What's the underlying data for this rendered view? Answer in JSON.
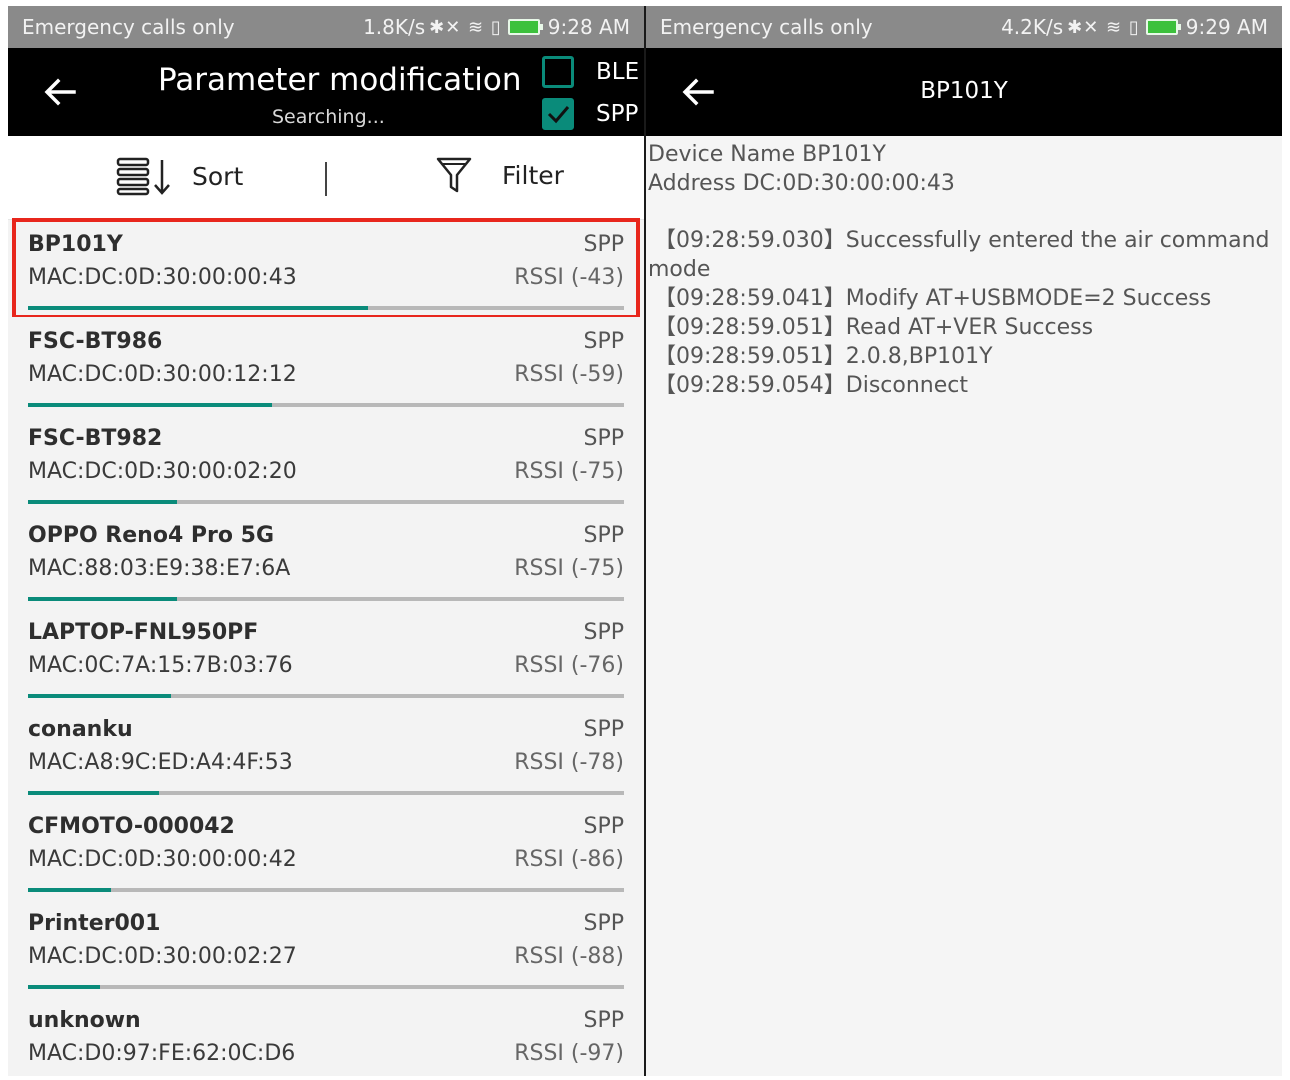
{
  "left": {
    "status": {
      "carrier": "Emergency calls only",
      "speed": "1.8K/s",
      "icons": "✱✕ ≋ ▯",
      "time": "9:28 AM"
    },
    "appbar": {
      "title": "Parameter modification",
      "subtitle": "Searching...",
      "ble_label": "BLE",
      "spp_label": "SPP",
      "ble_checked": false,
      "spp_checked": true
    },
    "toolbar": {
      "sort_label": "Sort",
      "filter_label": "Filter"
    },
    "devices": [
      {
        "name": "BP101Y",
        "type": "SPP",
        "mac": "MAC:DC:0D:30:00:00:43",
        "rssi": "RSSI (-43)",
        "signal": 0.57,
        "selected": true
      },
      {
        "name": "FSC-BT986",
        "type": "SPP",
        "mac": "MAC:DC:0D:30:00:12:12",
        "rssi": "RSSI (-59)",
        "signal": 0.41,
        "selected": false
      },
      {
        "name": "FSC-BT982",
        "type": "SPP",
        "mac": "MAC:DC:0D:30:00:02:20",
        "rssi": "RSSI (-75)",
        "signal": 0.25,
        "selected": false
      },
      {
        "name": "OPPO Reno4 Pro 5G",
        "type": "SPP",
        "mac": "MAC:88:03:E9:38:E7:6A",
        "rssi": "RSSI (-75)",
        "signal": 0.25,
        "selected": false
      },
      {
        "name": "LAPTOP-FNL950PF",
        "type": "SPP",
        "mac": "MAC:0C:7A:15:7B:03:76",
        "rssi": "RSSI (-76)",
        "signal": 0.24,
        "selected": false
      },
      {
        "name": "conanku",
        "type": "SPP",
        "mac": "MAC:A8:9C:ED:A4:4F:53",
        "rssi": "RSSI (-78)",
        "signal": 0.22,
        "selected": false
      },
      {
        "name": "CFMOTO-000042",
        "type": "SPP",
        "mac": "MAC:DC:0D:30:00:00:42",
        "rssi": "RSSI (-86)",
        "signal": 0.14,
        "selected": false
      },
      {
        "name": "Printer001",
        "type": "SPP",
        "mac": "MAC:DC:0D:30:00:02:27",
        "rssi": "RSSI (-88)",
        "signal": 0.12,
        "selected": false
      },
      {
        "name": "unknown",
        "type": "SPP",
        "mac": "MAC:D0:97:FE:62:0C:D6",
        "rssi": "RSSI (-97)",
        "signal": 0.03,
        "selected": false
      }
    ]
  },
  "right": {
    "status": {
      "carrier": "Emergency calls only",
      "speed": "4.2K/s",
      "icons": "✱✕ ≋ ▯",
      "time": "9:29 AM"
    },
    "appbar": {
      "title": "BP101Y"
    },
    "info": {
      "device_name": "Device Name BP101Y",
      "address": "Address DC:0D:30:00:00:43"
    },
    "log": [
      "【09:28:59.030】Successfully entered the air command",
      "mode",
      "【09:28:59.041】Modify AT+USBMODE=2 Success",
      "【09:28:59.051】Read AT+VER Success",
      "【09:28:59.051】2.0.8,BP101Y",
      "【09:28:59.054】Disconnect"
    ]
  },
  "colors": {
    "accent": "#0a8b7a",
    "highlight": "#e8261c",
    "statusbar": "#8a8a8a",
    "appbar": "#000000"
  }
}
